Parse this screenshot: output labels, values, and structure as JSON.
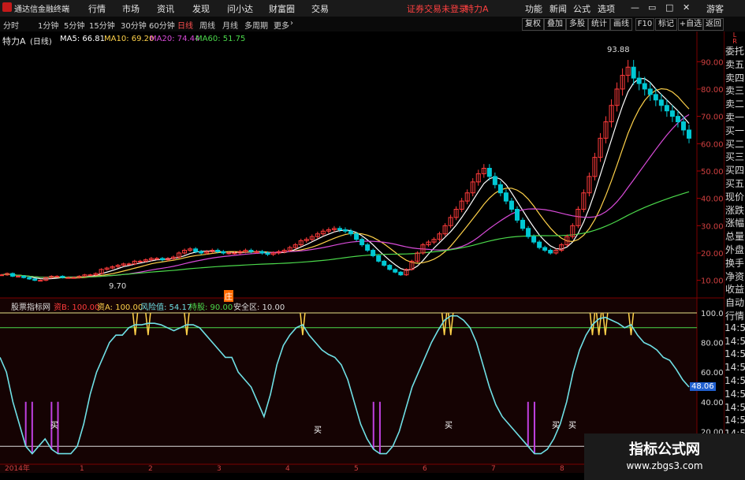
{
  "window": {
    "title": "通达信金融终端",
    "status": "证券交易未登录",
    "stock": "特力A",
    "btn_func": "功能",
    "btn_news": "新闻",
    "btn_formula": "公式",
    "btn_options": "选项",
    "btn_guest": "游客"
  },
  "menu": [
    "行情",
    "市场",
    "资讯",
    "发现",
    "问小达",
    "财富圈",
    "交易"
  ],
  "periods": [
    "分时",
    "1分钟",
    "5分钟",
    "15分钟",
    "30分钟",
    "60分钟",
    "日线",
    "周线",
    "月线",
    "多周期",
    "更多"
  ],
  "tools": [
    "复权",
    "叠加",
    "多股",
    "统计",
    "画线",
    "F10",
    "标记",
    "+自选",
    "返回"
  ],
  "main": {
    "title": "特力A",
    "period": "(日线)",
    "ma5": "MA5: 66.81",
    "ma10": "MA10: 69.20",
    "ma20": "MA20: 74.44",
    "ma60": "MA60: 51.75",
    "high_label": "93.88",
    "low_label": "9.70",
    "event_marker": "庄"
  },
  "y_axis_main": [
    "90.00",
    "80.00",
    "70.00",
    "60.00",
    "50.00",
    "40.00",
    "30.00",
    "20.00",
    "10.00"
  ],
  "indicator": {
    "name": "股票指标网",
    "b_label": "资B: 100.00",
    "a_label": "资A: 100.00",
    "risk": "风险值: 54.17",
    "hold": "持股: 90.00",
    "safe": "安全区: 10.00",
    "current": "48.06",
    "buy_text": "买"
  },
  "y_axis_ind": [
    "100.0",
    "80.00",
    "60.00",
    "40.00",
    "20.00"
  ],
  "x_axis": [
    "2014年",
    "1",
    "2",
    "3",
    "4",
    "5",
    "6",
    "7",
    "8",
    "9"
  ],
  "right_panel": [
    "L",
    "R",
    "委托",
    "卖五",
    "卖四",
    "卖三",
    "卖二",
    "卖一",
    "买一",
    "买二",
    "买三",
    "买四",
    "买五",
    "现价",
    "涨跌",
    "涨幅",
    "总量",
    "外盘",
    "换手",
    "净资",
    "收益",
    "自动",
    "行情",
    "14:50",
    "14:50",
    "14:50",
    "14:50",
    "14:50",
    "14:50",
    "14:50",
    "14:50",
    "14:50"
  ],
  "watermark": {
    "line1": "指标公式网",
    "line2": "www.zbgs3.com"
  },
  "colors": {
    "ma5": "#ffffff",
    "ma10": "#ffd24a",
    "ma20": "#d94bd9",
    "ma60": "#4bd94b",
    "up": "#ff3b3b",
    "down": "#00c8d4",
    "osc": "#6fe0e6",
    "accent": "#ff3b3b"
  },
  "chart_data": {
    "type": "candlestick",
    "x_ticks": [
      "2014年",
      "1",
      "2",
      "3",
      "4",
      "5",
      "6",
      "7",
      "8",
      "9"
    ],
    "ylim": [
      5,
      97
    ],
    "close": [
      12,
      12.5,
      11.5,
      11.5,
      11,
      10.5,
      10,
      10,
      11,
      11.5,
      11.5,
      11,
      11,
      11,
      11.5,
      12,
      12,
      12.5,
      14,
      14.5,
      15,
      15.5,
      16,
      16,
      17,
      17,
      17.5,
      18,
      18,
      17.5,
      18,
      18.5,
      20,
      21,
      21.5,
      20.5,
      20,
      20.5,
      21,
      20.5,
      20,
      20,
      20,
      20.5,
      21,
      20.5,
      20.5,
      20,
      19.5,
      20,
      20.5,
      21,
      22,
      23,
      24.5,
      25,
      26,
      27,
      28,
      28.5,
      29,
      28.5,
      28,
      27,
      25,
      23,
      21,
      19,
      17,
      15.5,
      14,
      13,
      12,
      14,
      17,
      20,
      23,
      24,
      25,
      27,
      30,
      33,
      36,
      39,
      42,
      46,
      49,
      51,
      48,
      45,
      42,
      39,
      36,
      32,
      29,
      26,
      24,
      22,
      21,
      20,
      21,
      23,
      26,
      30,
      36,
      42,
      48,
      55,
      62,
      68,
      74,
      80,
      85,
      88,
      84,
      82,
      80,
      78,
      76,
      74,
      72,
      70,
      68,
      65,
      62
    ],
    "ma_overlays": [
      "MA5",
      "MA10",
      "MA20",
      "MA60"
    ],
    "indicator": {
      "name": "股票指标网",
      "ylim": [
        0,
        100
      ],
      "values": [
        70,
        60,
        40,
        25,
        10,
        5,
        10,
        15,
        8,
        5,
        5,
        5,
        10,
        25,
        45,
        60,
        70,
        80,
        85,
        85,
        90,
        92,
        92,
        93,
        93,
        92,
        90,
        88,
        90,
        92,
        92,
        90,
        85,
        80,
        75,
        70,
        70,
        60,
        55,
        50,
        40,
        30,
        45,
        65,
        78,
        85,
        90,
        92,
        85,
        80,
        75,
        72,
        70,
        65,
        55,
        40,
        25,
        15,
        8,
        5,
        5,
        10,
        20,
        35,
        50,
        60,
        70,
        80,
        88,
        95,
        98,
        98,
        95,
        90,
        80,
        65,
        50,
        38,
        30,
        25,
        20,
        15,
        10,
        5,
        5,
        8,
        15,
        25,
        40,
        60,
        75,
        85,
        92,
        96,
        97,
        95,
        93,
        90,
        92,
        85,
        80,
        78,
        75,
        70,
        68,
        62,
        55,
        50
      ]
    }
  }
}
